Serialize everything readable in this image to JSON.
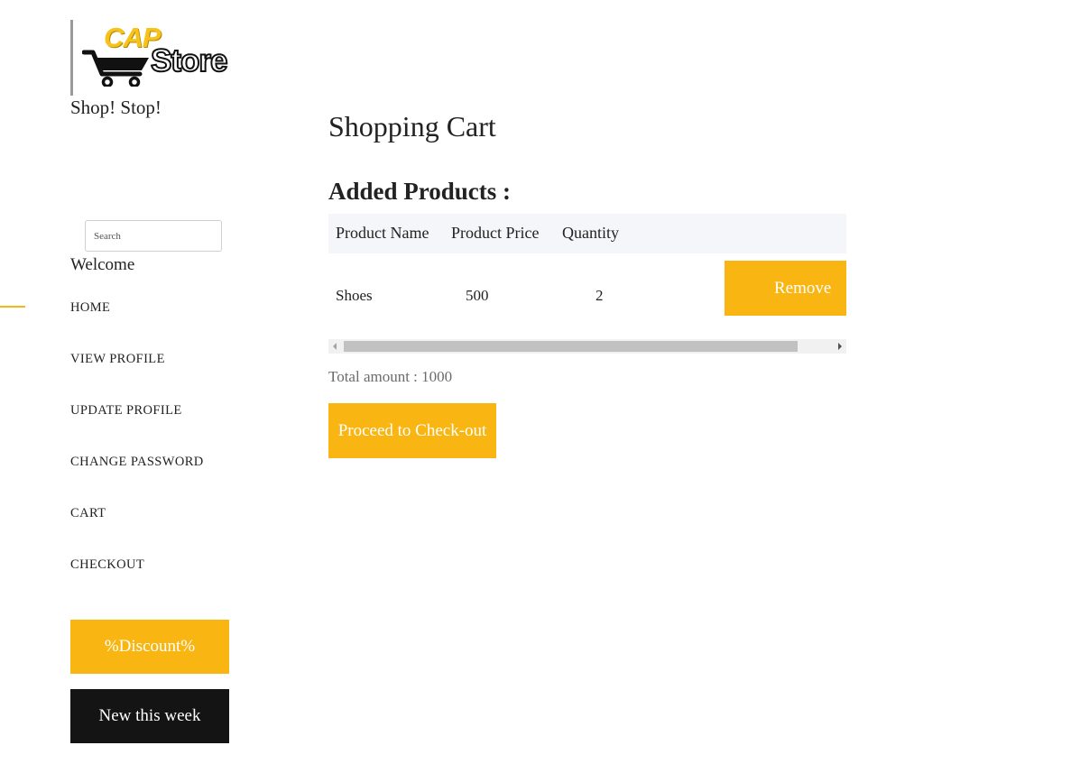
{
  "brand": {
    "logo_cap": "CAP",
    "logo_store": "Store",
    "tagline": "Shop! Stop!",
    "accent_color": "#f9b612"
  },
  "search": {
    "placeholder": "Search",
    "value": ""
  },
  "welcome": "Welcome",
  "nav": {
    "items": [
      {
        "label": "HOME",
        "active": true
      },
      {
        "label": "VIEW PROFILE"
      },
      {
        "label": "UPDATE PROFILE"
      },
      {
        "label": "CHANGE PASSWORD"
      },
      {
        "label": "CART"
      },
      {
        "label": "CHECKOUT"
      }
    ]
  },
  "promo": {
    "discount_label": "%Discount%",
    "new_label": "New this week"
  },
  "cart": {
    "title": "Shopping Cart",
    "subtitle": "Added Products :",
    "columns": [
      "Product Name",
      "Product Price",
      "Quantity"
    ],
    "rows": [
      {
        "name": "Shoes",
        "price": "500",
        "quantity": "2",
        "remove_label": "Remove"
      }
    ],
    "total_text": "Total amount : 1000",
    "checkout_label": "Proceed to Check-out"
  },
  "icons": [
    "shopping-cart-icon",
    "scroll-left-arrow-icon",
    "scroll-right-arrow-icon"
  ]
}
